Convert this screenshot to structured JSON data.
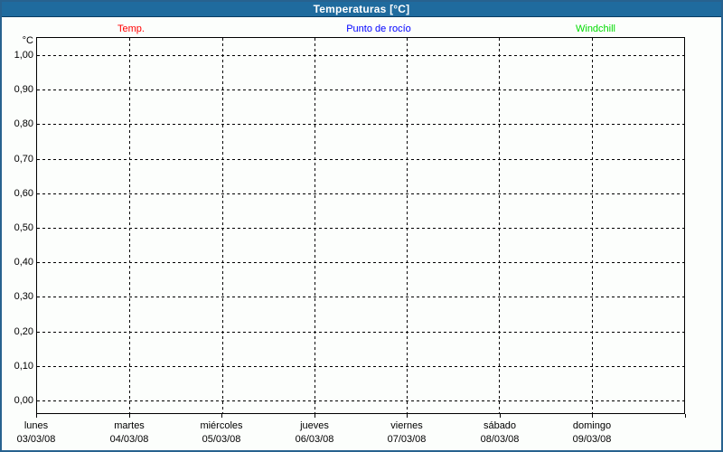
{
  "chart_data": {
    "type": "line",
    "title": "Temperaturas [°C]",
    "legend_position": "top",
    "grid": "dashed",
    "series": [
      {
        "name": "Temp.",
        "color": "#ff0000",
        "values": []
      },
      {
        "name": "Punto de rocío",
        "color": "#0000ff",
        "values": []
      },
      {
        "name": "Windchill",
        "color": "#00db00",
        "values": []
      }
    ],
    "y_axis": {
      "unit": "°C",
      "min": 0.0,
      "max": 1.0,
      "step": 0.1,
      "tick_labels": [
        "1,00",
        "0,90",
        "0,80",
        "0,70",
        "0,60",
        "0,50",
        "0,40",
        "0,30",
        "0,20",
        "0,10",
        "0,00"
      ]
    },
    "x_axis": {
      "days": [
        {
          "name": "lunes",
          "date": "03/03/08"
        },
        {
          "name": "martes",
          "date": "04/03/08"
        },
        {
          "name": "miércoles",
          "date": "05/03/08"
        },
        {
          "name": "jueves",
          "date": "06/03/08"
        },
        {
          "name": "viernes",
          "date": "07/03/08"
        },
        {
          "name": "sábado",
          "date": "08/03/08"
        },
        {
          "name": "domingo",
          "date": "09/03/08"
        }
      ]
    }
  },
  "colors": {
    "titlebar_bg": "#1f6b9e",
    "titlebar_edge": "#0a3c64",
    "frame_border": "#27628f",
    "panel_bg": "#fcfefc",
    "grid": "#000000"
  }
}
